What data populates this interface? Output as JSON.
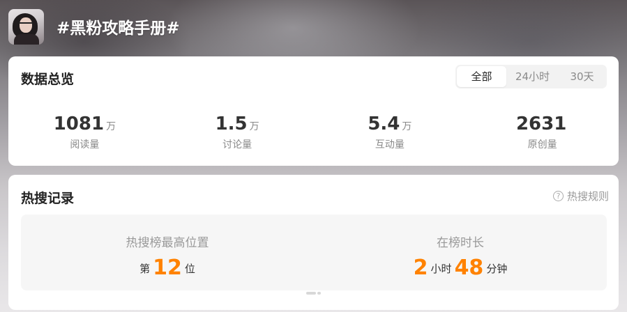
{
  "header": {
    "title": "#黑粉攻略手册#"
  },
  "overview": {
    "title": "数据总览",
    "tabs": [
      {
        "label": "全部",
        "active": true
      },
      {
        "label": "24小时",
        "active": false
      },
      {
        "label": "30天",
        "active": false
      }
    ],
    "stats": [
      {
        "value": "1081",
        "unit": "万",
        "label": "阅读量"
      },
      {
        "value": "1.5",
        "unit": "万",
        "label": "讨论量"
      },
      {
        "value": "5.4",
        "unit": "万",
        "label": "互动量"
      },
      {
        "value": "2631",
        "unit": "",
        "label": "原创量"
      }
    ]
  },
  "hotsearch": {
    "title": "热搜记录",
    "rule_label": "热搜规则",
    "peak": {
      "label": "热搜榜最高位置",
      "prefix": "第",
      "value": "12",
      "suffix": "位"
    },
    "duration": {
      "label": "在榜时长",
      "hours": "2",
      "hours_unit": "小时",
      "minutes": "48",
      "minutes_unit": "分钟"
    }
  },
  "colors": {
    "accent": "#ff8200",
    "card": "#ffffff",
    "panel": "#f6f6f6"
  },
  "icons": {
    "help": "help-circle-icon",
    "avatar": "user-avatar"
  }
}
